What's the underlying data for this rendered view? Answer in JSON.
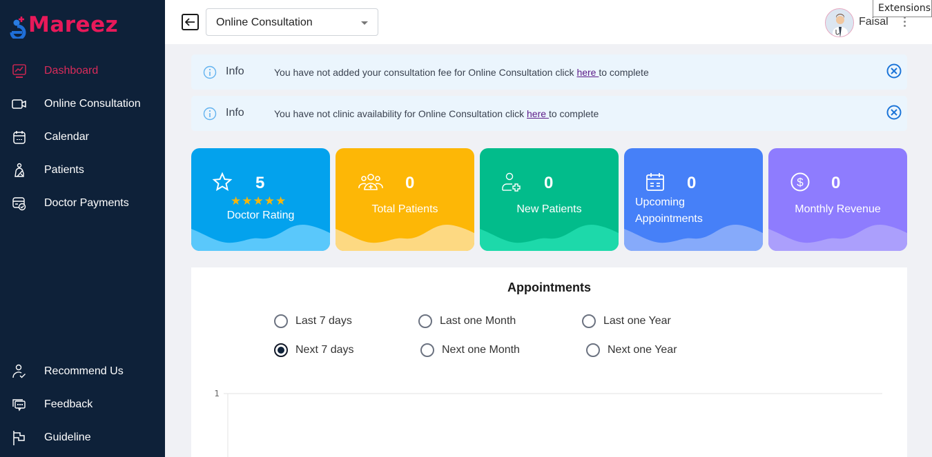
{
  "app": {
    "brand": "Mareez",
    "brand_color": "#e8195a",
    "accent_active": "#d92b5a"
  },
  "sidebar": {
    "items": [
      {
        "label": "Dashboard",
        "icon": "monitor-chart-icon",
        "active": true
      },
      {
        "label": "Online Consultation",
        "icon": "video-camera-icon",
        "active": false
      },
      {
        "label": "Calendar",
        "icon": "calendar-icon",
        "active": false
      },
      {
        "label": "Patients",
        "icon": "patient-icon",
        "active": false
      },
      {
        "label": "Doctor Payments",
        "icon": "payment-card-icon",
        "active": false
      }
    ],
    "bottom_items": [
      {
        "label": "Recommend Us",
        "icon": "user-check-icon"
      },
      {
        "label": "Feedback",
        "icon": "feedback-chat-icon"
      },
      {
        "label": "Guideline",
        "icon": "flag-icon"
      }
    ]
  },
  "topbar": {
    "selected_service": "Online Consultation",
    "user_name": "Faisal",
    "tooltip": "Extensions"
  },
  "alerts": [
    {
      "title": "Info",
      "message_before": "You have not added your consultation fee for Online Consultation click ",
      "link": "here ",
      "message_after": "to complete"
    },
    {
      "title": "Info",
      "message_before": "You have not clinic availability for Online Consultation click ",
      "link": "here ",
      "message_after": "to complete"
    }
  ],
  "cards": [
    {
      "label": "Doctor Rating",
      "value": "5",
      "stars": 5,
      "icon": "star-icon",
      "color": "#03a2ed",
      "wave": "#5ac8fb"
    },
    {
      "label": "Total Patients",
      "value": "0",
      "icon": "patients-group-icon",
      "color": "#fdb706",
      "wave": "#fdd982"
    },
    {
      "label": "New Patients",
      "value": "0",
      "icon": "add-patient-icon",
      "color": "#02bc8b",
      "wave": "#1dd9aa"
    },
    {
      "label": "Upcoming Appointments",
      "label_line1": "Upcoming",
      "label_line2": "Appointments",
      "value": "0",
      "icon": "calendar-icon",
      "color": "#4680f8",
      "wave": "#86aafa"
    },
    {
      "label": "Monthly Revenue",
      "value": "0",
      "icon": "dollar-circle-icon",
      "color": "#8e7cfe",
      "wave": "#ab9ffc"
    }
  ],
  "appointments": {
    "title": "Appointments",
    "ranges": [
      {
        "label": "Last 7 days",
        "checked": false
      },
      {
        "label": "Last one Month",
        "checked": false
      },
      {
        "label": "Last one Year",
        "checked": false
      },
      {
        "label": "Next 7 days",
        "checked": true
      },
      {
        "label": "Next one Month",
        "checked": false
      },
      {
        "label": "Next one Year",
        "checked": false
      }
    ]
  },
  "chart_data": {
    "type": "line",
    "title": "",
    "y_ticks": [
      "1"
    ],
    "ylim": [
      0,
      1
    ],
    "series": [],
    "grid": true
  }
}
